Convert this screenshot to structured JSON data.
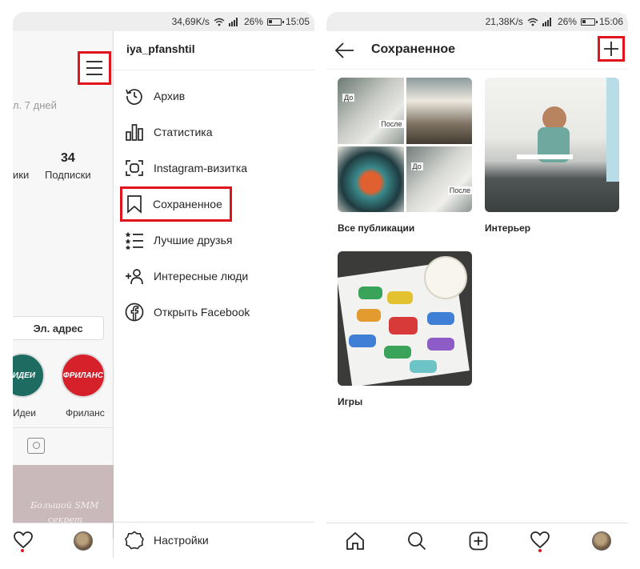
{
  "left_screen": {
    "status": {
      "speed": "34,69K/s",
      "battery": "26%",
      "time": "15:05"
    },
    "profile": {
      "last_days": "л. 7 дней",
      "followers_label_partial": "ики",
      "following_count": "34",
      "following_label": "Подписки",
      "email_button": "Эл. адрес",
      "highlights": [
        {
          "cover_text": "ИДЕИ",
          "label": "Идеи",
          "color": "#1e6b62"
        },
        {
          "cover_text": "ФРИЛАНС",
          "label": "Фриланс",
          "color": "#d6202a"
        }
      ],
      "post_text_line1": "Большой SMM",
      "post_text_line2": "секрет"
    },
    "drawer": {
      "username": "iya_pfanshtil",
      "items": [
        {
          "label": "Архив",
          "icon": "archive-history-icon"
        },
        {
          "label": "Статистика",
          "icon": "bar-chart-icon"
        },
        {
          "label": "Instagram-визитка",
          "icon": "nametag-scan-icon"
        },
        {
          "label": "Сохраненное",
          "icon": "bookmark-icon",
          "highlighted": true
        },
        {
          "label": "Лучшие друзья",
          "icon": "close-friends-list-icon"
        },
        {
          "label": "Интересные люди",
          "icon": "add-person-icon"
        },
        {
          "label": "Открыть Facebook",
          "icon": "facebook-icon"
        }
      ],
      "settings": "Настройки"
    }
  },
  "right_screen": {
    "status": {
      "speed": "21,38K/s",
      "battery": "26%",
      "time": "15:06"
    },
    "title": "Сохраненное",
    "collections": [
      {
        "name": "Все публикации",
        "labels": [
          "До",
          "После",
          "До",
          "После"
        ]
      },
      {
        "name": "Интерьер"
      },
      {
        "name": "Игры"
      }
    ],
    "nav_icons": [
      "home-icon",
      "search-icon",
      "new-post-icon",
      "activity-heart-icon",
      "profile-avatar"
    ]
  },
  "colors": {
    "highlight_red": "#e0141d",
    "notification_dot": "#e0141d"
  }
}
